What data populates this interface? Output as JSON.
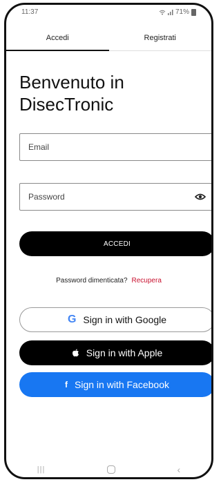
{
  "status_bar": {
    "time": "11:37",
    "battery": "71%"
  },
  "tabs": [
    {
      "label": "Accedi"
    },
    {
      "label": "Registrati"
    }
  ],
  "welcome": {
    "line1": "Benvenuto in",
    "line2": "DisecTronic"
  },
  "email": {
    "placeholder": "Email"
  },
  "password": {
    "placeholder": "Password"
  },
  "login_button": "ACCEDI",
  "forgot": {
    "text": "Password dimenticata?",
    "link": "Recupera"
  },
  "social": {
    "google": "Sign in with Google",
    "apple": "Sign in with Apple",
    "facebook": "Sign in with Facebook"
  },
  "colors": {
    "accent_red": "#c8102e",
    "facebook_blue": "#1877f2",
    "google_blue": "#4285f4"
  },
  "icons": [
    "wifi-icon",
    "signal-icon",
    "battery-icon",
    "eye-icon",
    "google-icon",
    "apple-icon",
    "facebook-icon",
    "recents-icon",
    "home-icon",
    "back-icon"
  ]
}
